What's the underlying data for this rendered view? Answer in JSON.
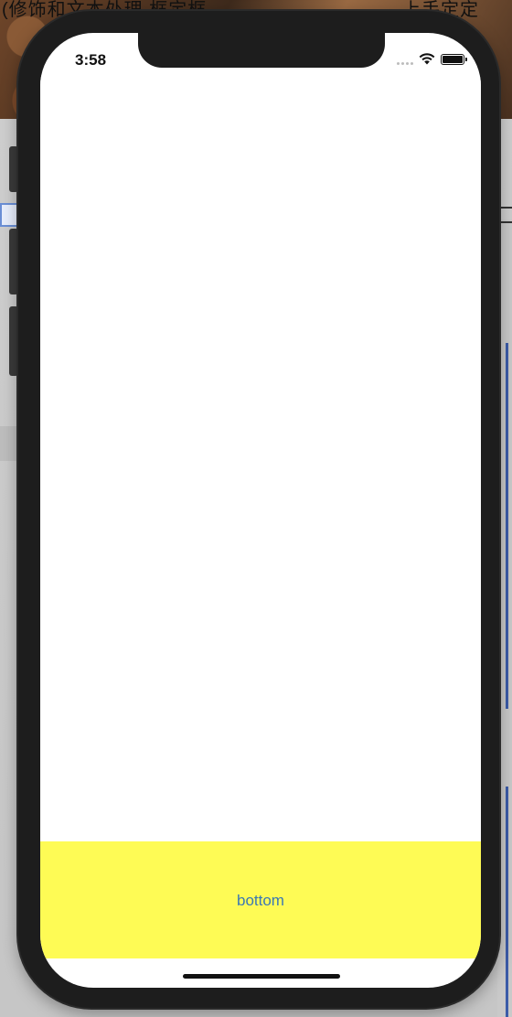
{
  "background": {
    "window_title_left": "(修饰和文本处理 框定框",
    "window_title_right": "上手定定"
  },
  "status_bar": {
    "time": "3:58",
    "icons": [
      "cellular-dots-icon",
      "wifi-icon",
      "battery-icon"
    ]
  },
  "bottom_bar": {
    "label": "bottom",
    "background_color": "#fefb55",
    "text_color": "#3b78b4"
  }
}
